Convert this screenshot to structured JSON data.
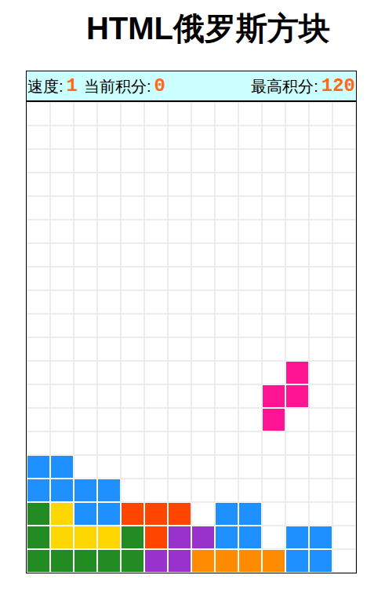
{
  "title": "HTML俄罗斯方块",
  "status_bar": {
    "speed": {
      "label": "速度:",
      "value": "1"
    },
    "score": {
      "label": "当前积分:",
      "value": "0"
    },
    "high_score": {
      "label": "最高积分:",
      "value": "120"
    }
  },
  "board": {
    "rows": [
      [
        "",
        "",
        "",
        "",
        "",
        "",
        "",
        "",
        "",
        "",
        "",
        "",
        "",
        ""
      ],
      [
        "",
        "",
        "",
        "",
        "",
        "",
        "",
        "",
        "",
        "",
        "",
        "",
        "",
        ""
      ],
      [
        "",
        "",
        "",
        "",
        "",
        "",
        "",
        "",
        "",
        "",
        "",
        "",
        "",
        ""
      ],
      [
        "",
        "",
        "",
        "",
        "",
        "",
        "",
        "",
        "",
        "",
        "",
        "",
        "",
        ""
      ],
      [
        "",
        "",
        "",
        "",
        "",
        "",
        "",
        "",
        "",
        "",
        "",
        "",
        "",
        ""
      ],
      [
        "",
        "",
        "",
        "",
        "",
        "",
        "",
        "",
        "",
        "",
        "",
        "",
        "",
        ""
      ],
      [
        "",
        "",
        "",
        "",
        "",
        "",
        "",
        "",
        "",
        "",
        "",
        "",
        "",
        ""
      ],
      [
        "",
        "",
        "",
        "",
        "",
        "",
        "",
        "",
        "",
        "",
        "",
        "",
        "",
        ""
      ],
      [
        "",
        "",
        "",
        "",
        "",
        "",
        "",
        "",
        "",
        "",
        "",
        "",
        "",
        ""
      ],
      [
        "",
        "",
        "",
        "",
        "",
        "",
        "",
        "",
        "",
        "",
        "",
        "",
        "",
        ""
      ],
      [
        "",
        "",
        "",
        "",
        "",
        "",
        "",
        "",
        "",
        "",
        "",
        "",
        "",
        ""
      ],
      [
        "",
        "",
        "",
        "",
        "",
        "",
        "",
        "",
        "",
        "",
        "",
        "#ff1493",
        "",
        ""
      ],
      [
        "",
        "",
        "",
        "",
        "",
        "",
        "",
        "",
        "",
        "",
        "#ff1493",
        "#ff1493",
        "",
        ""
      ],
      [
        "",
        "",
        "",
        "",
        "",
        "",
        "",
        "",
        "",
        "",
        "#ff1493",
        "",
        "",
        ""
      ],
      [
        "",
        "",
        "",
        "",
        "",
        "",
        "",
        "",
        "",
        "",
        "",
        "",
        "",
        ""
      ],
      [
        "#1e90ff",
        "#1e90ff",
        "",
        "",
        "",
        "",
        "",
        "",
        "",
        "",
        "",
        "",
        "",
        ""
      ],
      [
        "#1e90ff",
        "#1e90ff",
        "#1e90ff",
        "#1e90ff",
        "",
        "",
        "",
        "",
        "",
        "",
        "",
        "",
        "",
        ""
      ],
      [
        "#228b22",
        "#ffd700",
        "#1e90ff",
        "#1e90ff",
        "#ff4500",
        "#ff4500",
        "#ff4500",
        "",
        "#1e90ff",
        "#1e90ff",
        "",
        "",
        "",
        ""
      ],
      [
        "#228b22",
        "#ffd700",
        "#ffd700",
        "#ffd700",
        "#228b22",
        "#ff4500",
        "#9932cc",
        "#9932cc",
        "#1e90ff",
        "#1e90ff",
        "",
        "#1e90ff",
        "#1e90ff",
        ""
      ],
      [
        "#228b22",
        "#228b22",
        "#228b22",
        "#228b22",
        "#228b22",
        "#9932cc",
        "#9932cc",
        "#ff8c00",
        "#ff8c00",
        "#ff8c00",
        "#ff8c00",
        "#1e90ff",
        "#1e90ff",
        ""
      ]
    ]
  }
}
